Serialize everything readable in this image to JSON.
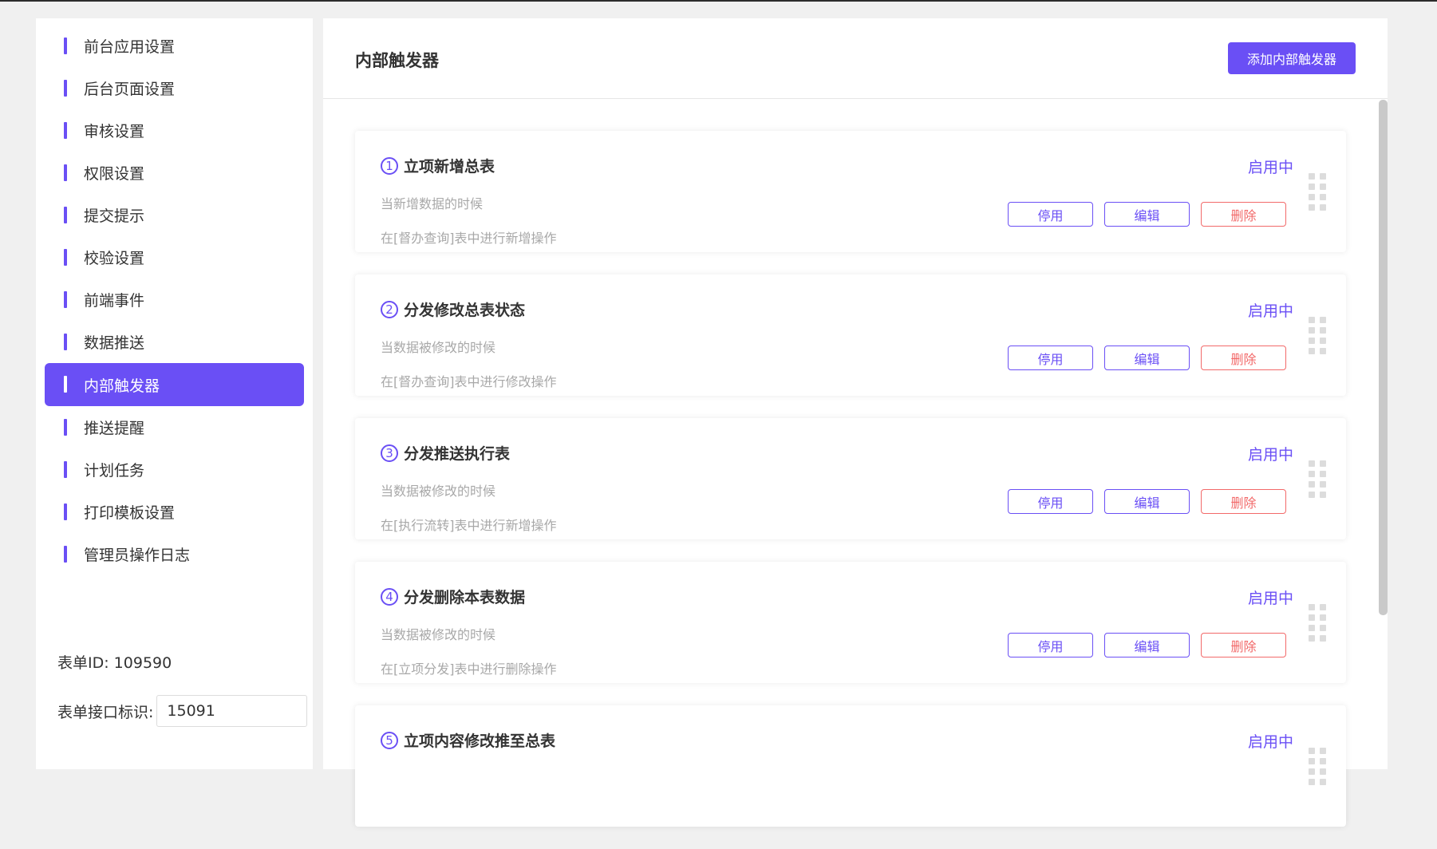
{
  "sidebar": {
    "items": [
      {
        "label": "前台应用设置"
      },
      {
        "label": "后台页面设置"
      },
      {
        "label": "审核设置"
      },
      {
        "label": "权限设置"
      },
      {
        "label": "提交提示"
      },
      {
        "label": "校验设置"
      },
      {
        "label": "前端事件"
      },
      {
        "label": "数据推送"
      },
      {
        "label": "内部触发器"
      },
      {
        "label": "推送提醒"
      },
      {
        "label": "计划任务"
      },
      {
        "label": "打印模板设置"
      },
      {
        "label": "管理员操作日志"
      }
    ],
    "active_index": 8,
    "form_id": "表单ID: 109590",
    "api_label": "表单接口标识:",
    "api_value": "15091"
  },
  "main": {
    "title": "内部触发器",
    "add_button": "添加内部触发器",
    "cards": [
      {
        "num": "1",
        "title": "立项新增总表",
        "status": "启用中",
        "desc1": "当新增数据的时候",
        "desc2": "在[督办查询]表中进行新增操作",
        "disable": "停用",
        "edit": "编辑",
        "delete": "删除"
      },
      {
        "num": "2",
        "title": "分发修改总表状态",
        "status": "启用中",
        "desc1": "当数据被修改的时候",
        "desc2": "在[督办查询]表中进行修改操作",
        "disable": "停用",
        "edit": "编辑",
        "delete": "删除"
      },
      {
        "num": "3",
        "title": "分发推送执行表",
        "status": "启用中",
        "desc1": "当数据被修改的时候",
        "desc2": "在[执行流转]表中进行新增操作",
        "disable": "停用",
        "edit": "编辑",
        "delete": "删除"
      },
      {
        "num": "4",
        "title": "分发删除本表数据",
        "status": "启用中",
        "desc1": "当数据被修改的时候",
        "desc2": "在[立项分发]表中进行删除操作",
        "disable": "停用",
        "edit": "编辑",
        "delete": "删除"
      },
      {
        "num": "5",
        "title": "立项内容修改推至总表",
        "status": "启用中",
        "desc1": "",
        "desc2": "",
        "disable": "",
        "edit": "",
        "delete": ""
      }
    ]
  },
  "colors": {
    "accent": "#6a4ff5",
    "danger": "#f26a6a",
    "muted_text": "#a8a8a8"
  }
}
